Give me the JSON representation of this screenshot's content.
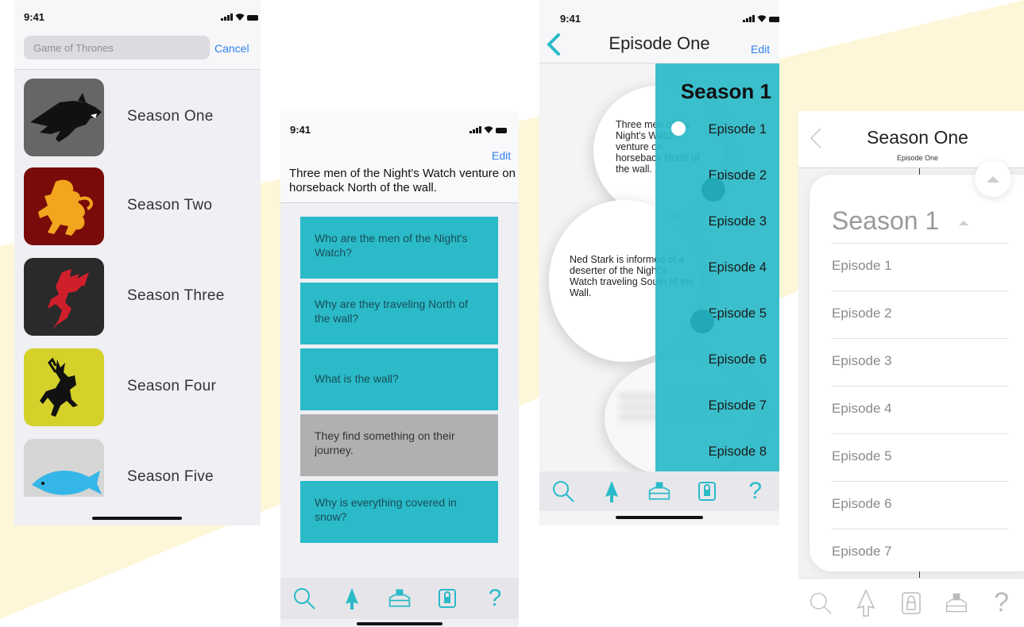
{
  "colors": {
    "accent": "#2abac8",
    "link": "#2f80ed",
    "band": "#fdf6d8"
  },
  "screen_search": {
    "time": "9:41",
    "search": {
      "value": "Game of Thrones"
    },
    "cancel_label": "Cancel",
    "seasons": [
      {
        "label": "Season One",
        "icon": "wolf-sigil-icon",
        "color": "#666666"
      },
      {
        "label": "Season Two",
        "icon": "lion-sigil-icon",
        "color": "#7a0b0b"
      },
      {
        "label": "Season Three",
        "icon": "dragon-sigil-icon",
        "color": "#2a2a2a"
      },
      {
        "label": "Season Four",
        "icon": "stag-sigil-icon",
        "color": "#d4d22a"
      },
      {
        "label": "Season Five",
        "icon": "fish-sigil-icon",
        "color": "#d6d6d6"
      }
    ]
  },
  "screen_questions": {
    "time": "9:41",
    "edit_label": "Edit",
    "intro": "Three men of the Night's Watch venture on horseback North of the wall.",
    "questions": [
      {
        "text": "Who are the men of the Night's Watch?"
      },
      {
        "text": "Why are they traveling North of the wall?"
      },
      {
        "text": "What is the wall?"
      },
      {
        "text": "They find something on their journey."
      },
      {
        "text": "Why is everything covered in snow?"
      }
    ],
    "tabs": [
      "search-icon",
      "tree-icon",
      "inbox-icon",
      "lock-icon",
      "help-icon"
    ]
  },
  "screen_episode": {
    "time": "9:41",
    "title": "Episode One",
    "edit_label": "Edit",
    "bubbles": [
      {
        "text": "Three men of the Night's Watch venture on horseback North of the wall."
      },
      {
        "text": "Ned Stark is informed of a deserter of the Night's Watch traveling South of the Wall."
      }
    ],
    "drawer": {
      "title": "Season 1",
      "episodes": [
        "Episode 1",
        "Episode 2",
        "Episode 3",
        "Episode 4",
        "Episode 5",
        "Episode 6",
        "Episode 7",
        "Episode 8"
      ]
    }
  },
  "screen_season": {
    "title": "Season One",
    "subtitle": "Episode One",
    "card_title": "Season 1",
    "episodes": [
      "Episode 1",
      "Episode 2",
      "Episode 3",
      "Episode 4",
      "Episode 5",
      "Episode 6",
      "Episode 7"
    ]
  }
}
